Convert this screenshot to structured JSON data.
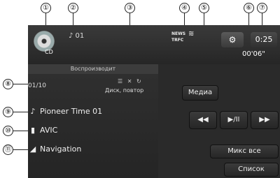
{
  "callouts": [
    "①",
    "②",
    "③",
    "④",
    "⑤",
    "⑥",
    "⑦",
    "⑧",
    "⑨",
    "⑩",
    "⑪"
  ],
  "top": {
    "source_label": "CD",
    "track_number": "♪ 01",
    "news_label": "NEWS",
    "trfc_label": "TRFC",
    "clock": "0:25",
    "elapsed": "00'06\""
  },
  "panel": {
    "status": "Воспроизводит",
    "track_count": "01/10",
    "repeat_icons": "☰ ✕ ↻",
    "repeat_mode": "Диск, повтор",
    "rows": [
      {
        "icon": "♪",
        "text": "Pioneer Time 01"
      },
      {
        "icon": "▮",
        "text": "AVIC"
      },
      {
        "icon": "◢",
        "text": "Navigation"
      }
    ]
  },
  "buttons": {
    "media": "Медиа",
    "prev": "◀◀",
    "play_pause": "▶/II",
    "next": "▶▶",
    "shuffle_all": "Микс все",
    "list": "Список"
  }
}
